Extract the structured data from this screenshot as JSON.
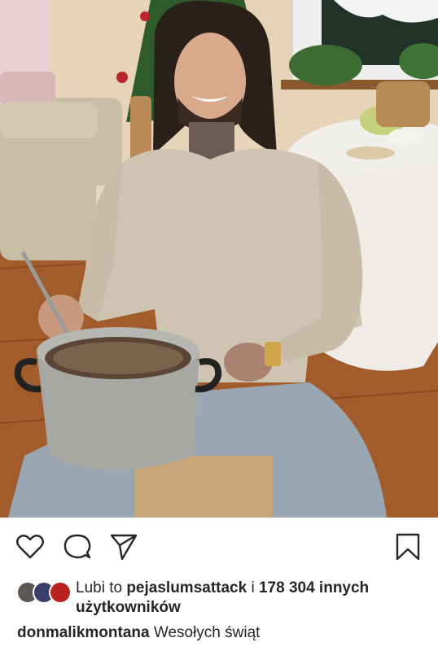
{
  "post": {
    "photo": {
      "description_icon": "photo-image",
      "colors": {
        "wall": "#e9d8c0",
        "floor": "#a8612e",
        "sweater": "#cfc3b2",
        "jeans": "#9aa7b3",
        "pot": "#a9a9a6"
      }
    },
    "actions": {
      "like_icon": "heart-icon",
      "comment_icon": "comment-icon",
      "share_icon": "paper-plane-icon",
      "save_icon": "bookmark-icon"
    },
    "likes": {
      "prefix": "Lubi to ",
      "user": "pejaslumsattack",
      "middle": " i ",
      "count": "178 304 innych użytkowników"
    },
    "caption": {
      "username": "donmalikmontana",
      "text": "Wesołych świąt"
    }
  }
}
